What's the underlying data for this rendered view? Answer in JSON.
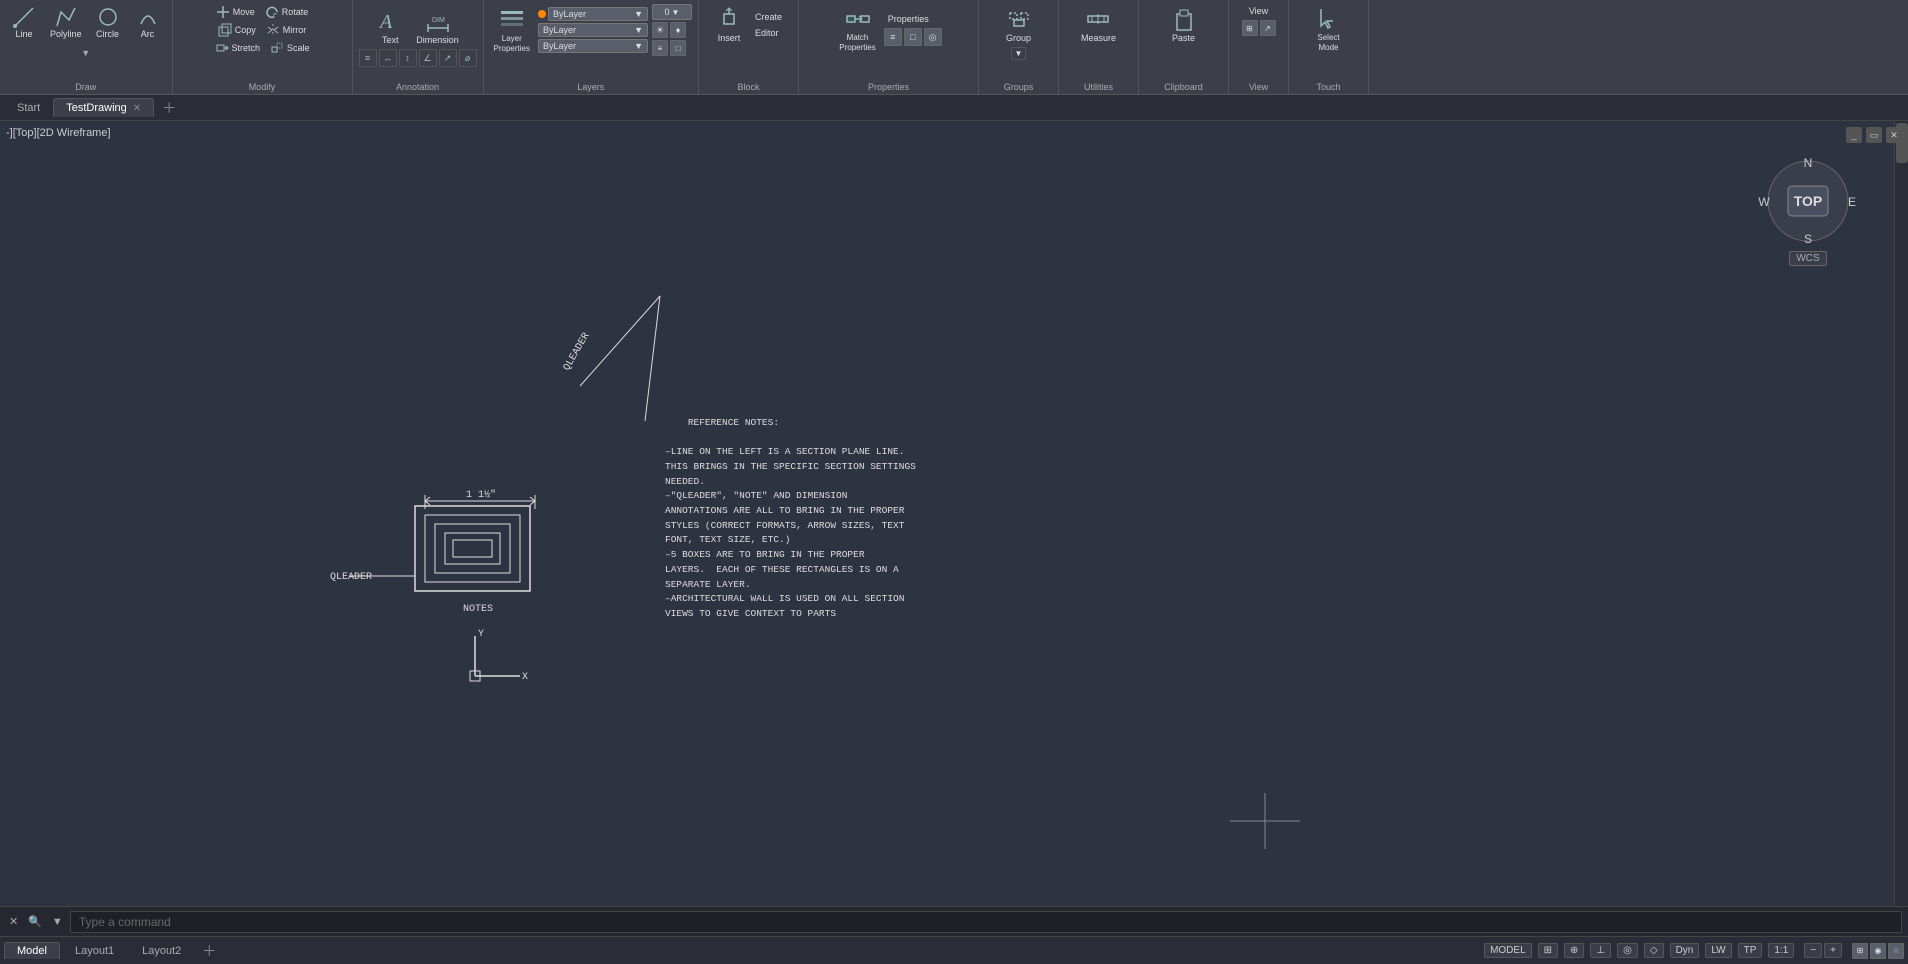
{
  "toolbar": {
    "sections": {
      "draw": {
        "label": "Draw",
        "items": [
          "Line",
          "Polyline",
          "Circle",
          "Arc",
          "Text",
          "Dimension"
        ]
      },
      "modify": {
        "label": "Modify",
        "items": [
          "Move",
          "Rotate",
          "Copy",
          "Mirror",
          "Stretch",
          "Scale"
        ]
      },
      "annotation": {
        "label": "Annotation",
        "text_label": "Text",
        "dim_label": "Dimension"
      },
      "layers": {
        "label": "Layers",
        "layer_props_label": "Layer\nProperties",
        "bylayer1": "ByLayer",
        "bylayer2": "ByLayer",
        "bylayer3": "ByLayer",
        "number": "0"
      },
      "block": {
        "label": "Block",
        "insert_label": "Insert",
        "block_label": "Block"
      },
      "properties": {
        "label": "Properties",
        "match_label": "Match\nProperties"
      },
      "groups": {
        "label": "Groups",
        "group_label": "Group"
      },
      "utilities": {
        "label": "Utilities",
        "measure_label": "Measure"
      },
      "clipboard": {
        "label": "Clipboard",
        "paste_label": "Paste"
      },
      "view": {
        "label": "View",
        "view_label": "View"
      },
      "select": {
        "label": "Select Mode",
        "select_label": "Select\nMode"
      }
    }
  },
  "tabs": {
    "start": "Start",
    "drawing": "TestDrawing",
    "add_tooltip": "New Tab"
  },
  "view_label": "-][Top][2D Wireframe]",
  "compass": {
    "n": "N",
    "s": "S",
    "e": "E",
    "w": "W",
    "top": "TOP",
    "wcs": "WCS"
  },
  "drawing": {
    "qleader_rotated_text": "QLEADER",
    "qleader_left_text": "QLEADER",
    "notes_text": "NOTES",
    "dimension_text": "1 1½\"",
    "reference_notes": "REFERENCE NOTES:\n\n–LINE ON THE LEFT IS A SECTION PLANE LINE.\nTHIS BRINGS IN THE SPECIFIC SECTION SETTINGS\nNEEDED.\n–\"QLEADER\", \"NOTE\" AND DIMENSION\nANNOTATIONS ARE ALL TO BRING IN THE PROPER\nSTYLES (CORRECT FORMATS, ARROW SIZES, TEXT\nFONT, TEXT SIZE, ETC.)\n–5 BOXES ARE TO BRING IN THE PROPER\nLAYERS.  EACH OF THESE RECTANGLES IS ON A\nSEPARATE LAYER.\n–ARCHITECTURAL WALL IS USED ON ALL SECTION\nVIEWS TO GIVE CONTEXT TO PARTS"
  },
  "status_bar": {
    "command_placeholder": "Type a command",
    "model_label": "MODEL"
  },
  "bottom_tabs": {
    "model": "Model",
    "layout1": "Layout1",
    "layout2": "Layout2"
  }
}
